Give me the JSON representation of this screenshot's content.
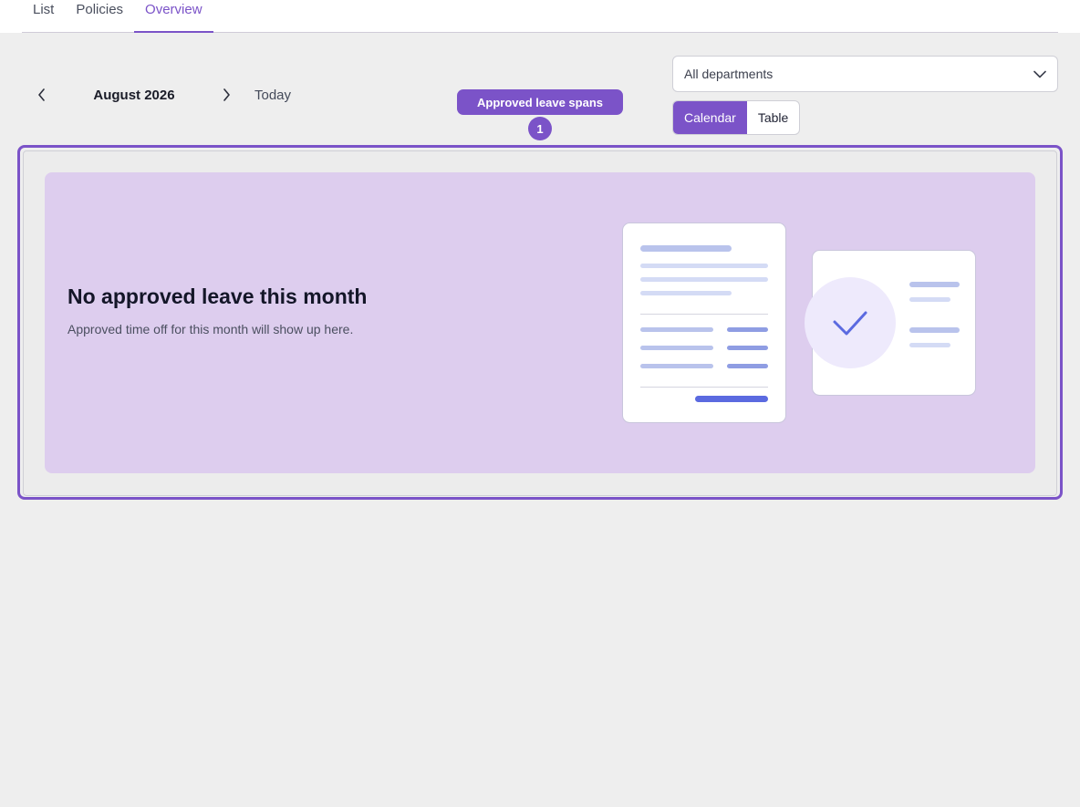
{
  "tabs": [
    {
      "label": "List",
      "active": false
    },
    {
      "label": "Policies",
      "active": false
    },
    {
      "label": "Overview",
      "active": true
    }
  ],
  "month_nav": {
    "prev_icon": "chevron-left-icon",
    "month_label": "August 2026",
    "next_icon": "chevron-right-icon",
    "today_label": "Today"
  },
  "tooltip": {
    "label": "Approved leave spans",
    "marker": "1"
  },
  "filters": {
    "department_value": "All departments",
    "dropdown_icon": "chevron-down-icon"
  },
  "view_toggle": {
    "calendar_label": "Calendar",
    "table_label": "Table",
    "selected": "Calendar"
  },
  "empty_state": {
    "title": "No approved leave this month",
    "subtitle": "Approved time off for this month will show up here.",
    "illustration_icon": "check-icon"
  },
  "colors": {
    "accent": "#7b53c8",
    "empty_bg": "#ddcdee",
    "page_bg": "#eeeeee"
  }
}
